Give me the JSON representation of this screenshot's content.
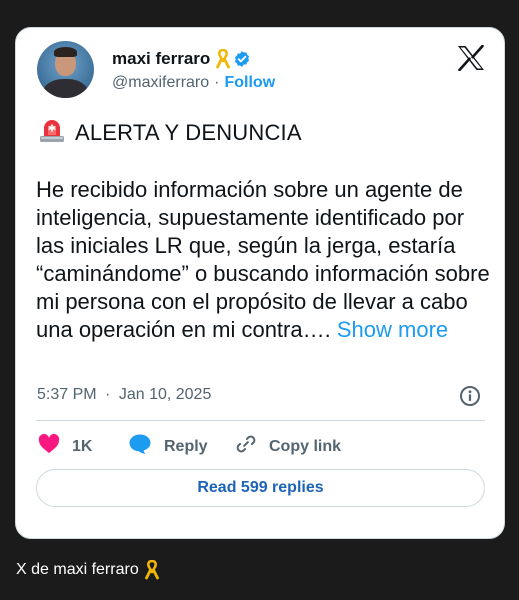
{
  "author": {
    "name": "maxi ferraro",
    "handle": "@maxiferraro",
    "separator": "·",
    "follow_label": "Follow"
  },
  "tweet": {
    "alert_icon": "rotating-light-emoji",
    "alert_heading": "ALERTA Y DENUNCIA",
    "body": "He recibido información sobre un agente de inteligencia, supuestamente identificado por las iniciales LR que, según la jerga, estaría “caminándome” o buscando información sobre mi persona con el propósito de llevar a cabo una operación en mi contra….",
    "show_more": "Show more",
    "time": "5:37 PM",
    "date_separator": "·",
    "date": "Jan 10, 2025"
  },
  "actions": {
    "like_count": "1K",
    "reply_label": "Reply",
    "copy_link_label": "Copy link"
  },
  "read_replies_label": "Read 599 replies",
  "caption": "X de maxi ferraro",
  "colors": {
    "accent": "#1d9bf0",
    "like": "#f91880",
    "text": "#0f1419",
    "muted": "#536471",
    "background": "#1b1b1b"
  }
}
